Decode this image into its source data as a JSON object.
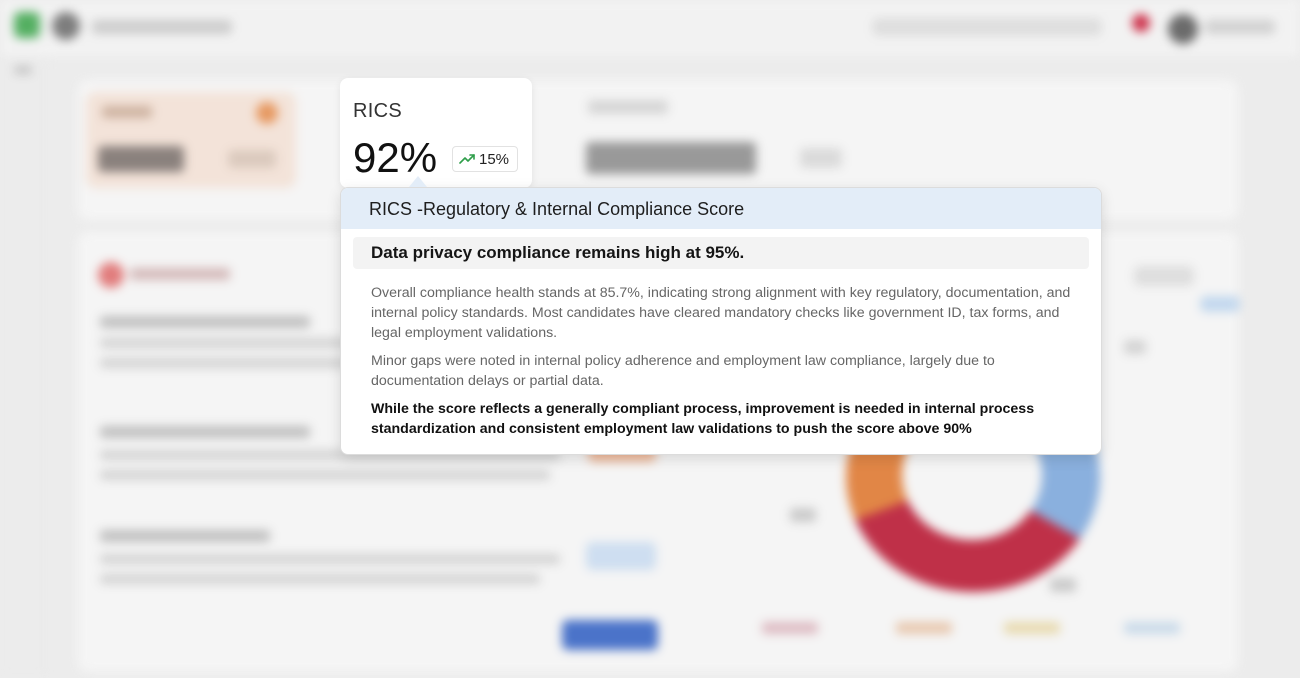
{
  "metric_card": {
    "title": "RICS",
    "value": "92%",
    "trend": {
      "icon": "trending-up-icon",
      "value": "15%",
      "color": "#2e9e4a"
    }
  },
  "tooltip": {
    "header": "RICS -Regulatory & Internal Compliance Score",
    "highlight": "Data privacy compliance remains high at 95%.",
    "paragraphs": [
      "Overall compliance health stands at 85.7%, indicating strong alignment with key regulatory, documentation, and internal policy standards. Most candidates have cleared mandatory checks like government ID, tax forms, and legal employment validations.",
      "Minor gaps were noted in internal policy adherence and employment law compliance, largely due to documentation delays or partial data.",
      "While the score reflects a generally compliant process, improvement is needed in internal process standardization and consistent employment law validations to push the score above 90%"
    ]
  },
  "colors": {
    "tooltip_header_bg": "#e3edf8",
    "highlight_bg": "#f3f3f3",
    "trend_green": "#2e9e4a",
    "background_overlay": "#ececec"
  }
}
